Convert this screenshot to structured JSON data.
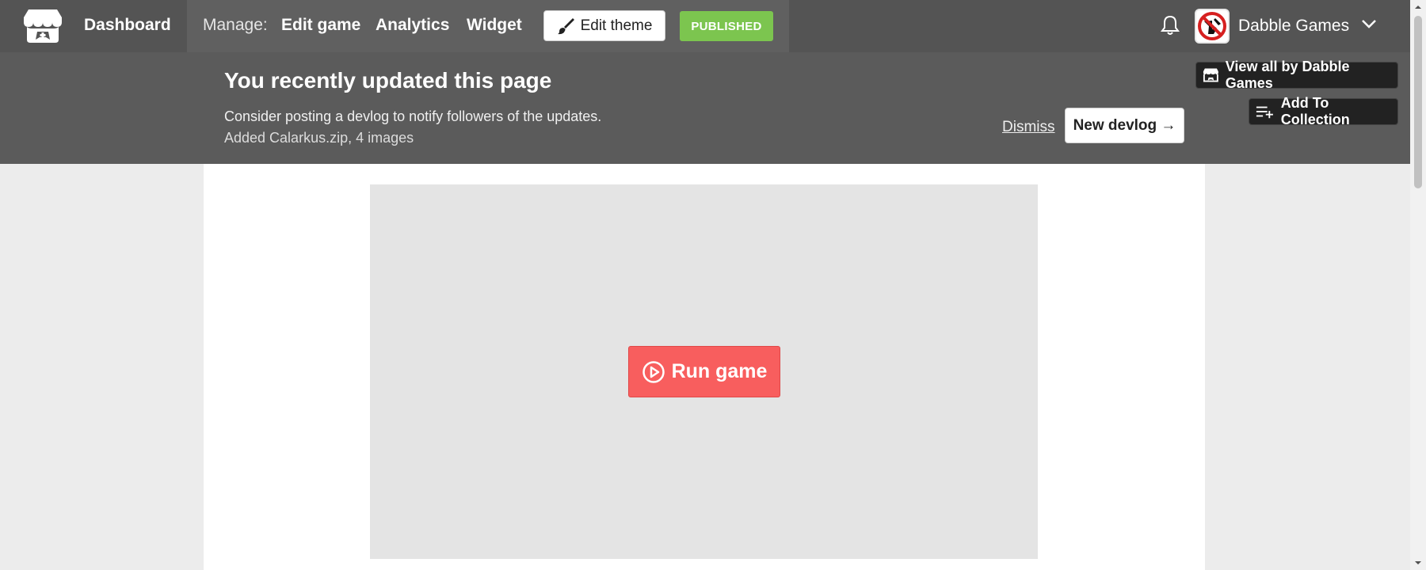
{
  "topbar": {
    "dashboard_label": "Dashboard",
    "manage_label": "Manage:",
    "nav": [
      "Edit game",
      "Analytics",
      "Widget"
    ],
    "edit_theme_label": "Edit theme",
    "published_label": "PUBLISHED",
    "user_name": "Dabble Games"
  },
  "banner": {
    "title": "You recently updated this page",
    "message": "Consider posting a devlog to notify followers of the updates.",
    "details": "Added Calarkus.zip, 4 images",
    "dismiss_label": "Dismiss",
    "new_devlog_label": "New devlog →"
  },
  "side_buttons": {
    "view_all_label": "View all by Dabble Games",
    "add_collection_label": "Add To Collection"
  },
  "game": {
    "run_label": "Run game"
  },
  "colors": {
    "topbar": "#545454",
    "banner": "#5b5b5b",
    "published": "#7cc54f",
    "run_button": "#f85e5e"
  },
  "icons": {
    "logo": "itchio-logo-icon",
    "brush": "paintbrush-icon",
    "bell": "bell-icon",
    "chevron": "chevron-down-icon",
    "store": "store-icon",
    "add_list": "playlist-add-icon",
    "play": "play-circle-icon"
  }
}
